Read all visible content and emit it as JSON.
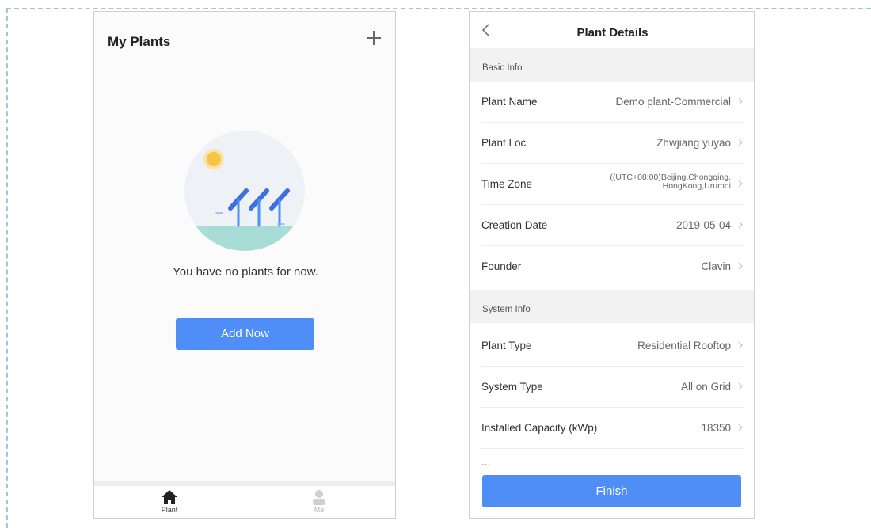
{
  "my_plants": {
    "title": "My Plants",
    "empty_message": "You have no plants for now.",
    "add_button": "Add Now",
    "tabs": [
      {
        "label": "Plant",
        "icon": "home-icon"
      },
      {
        "label": "Me",
        "icon": "person-icon"
      }
    ]
  },
  "plant_details": {
    "title": "Plant Details",
    "basic_info_label": "Basic Info",
    "basic_info": [
      {
        "label": "Plant Name",
        "value": "Demo plant-Commercial"
      },
      {
        "label": "Plant Loc",
        "value": "Zhwjiang yuyao"
      },
      {
        "label": "Time Zone",
        "value_line1": "((UTC+08:00)Beijing,Chongqing,",
        "value_line2": "HongKong,Urumqi"
      },
      {
        "label": "Creation Date",
        "value": "2019-05-04"
      },
      {
        "label": "Founder",
        "value": "Clavin"
      }
    ],
    "system_info_label": "System Info",
    "system_info": [
      {
        "label": "Plant Type",
        "value": "Residential Rooftop"
      },
      {
        "label": "System Type",
        "value": "All on Grid"
      },
      {
        "label": "Installed Capacity (kWp)",
        "value": "18350"
      }
    ],
    "partial_row_label": "...",
    "finish_button": "Finish"
  },
  "colors": {
    "accent": "#4f8ef7",
    "section_bg": "#f2f2f2",
    "frame_dash": "#9ec8dc"
  }
}
